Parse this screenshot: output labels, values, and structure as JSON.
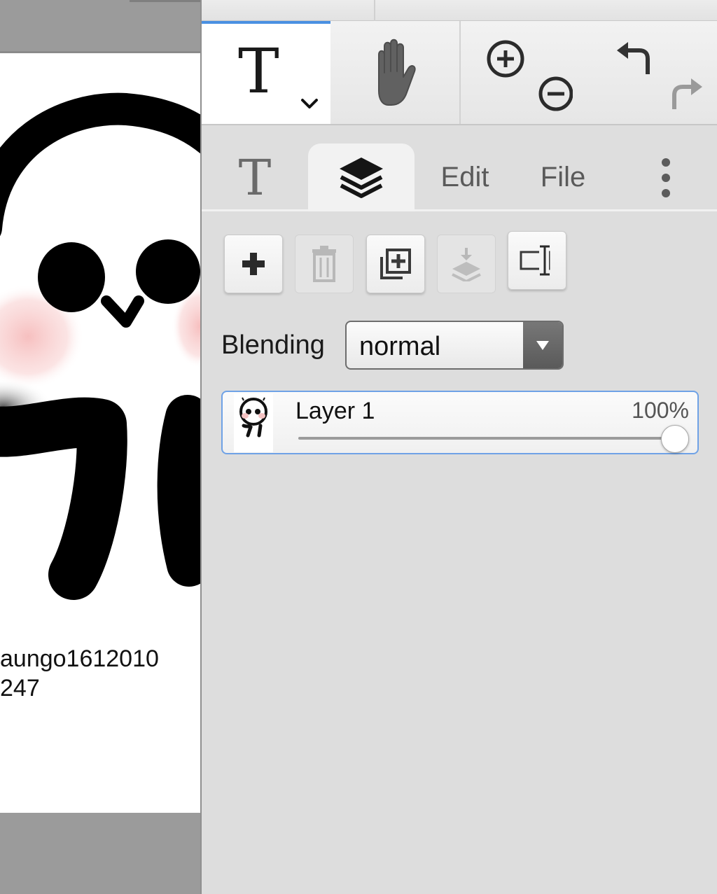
{
  "canvas": {
    "caption_line1": "aungo1612010",
    "caption_line2": "247"
  },
  "toolbar": {
    "text_tool_glyph": "T",
    "active_tool": "text",
    "icons": [
      "text-tool-icon",
      "hand-icon",
      "zoom-in-icon",
      "zoom-out-icon",
      "undo-icon",
      "redo-icon"
    ]
  },
  "tabs": {
    "text_glyph": "T",
    "edit_label": "Edit",
    "file_label": "File",
    "active": "layers"
  },
  "layers_panel": {
    "buttons": [
      {
        "name": "add-layer",
        "icon": "plus-icon",
        "enabled": true
      },
      {
        "name": "delete-layer",
        "icon": "trash-icon",
        "enabled": false
      },
      {
        "name": "duplicate-layer",
        "icon": "duplicate-icon",
        "enabled": true
      },
      {
        "name": "merge-down",
        "icon": "merge-down-icon",
        "enabled": false
      },
      {
        "name": "rename-layer",
        "icon": "rename-icon",
        "enabled": true
      }
    ],
    "blending_label": "Blending",
    "blending_value": "normal",
    "layers": [
      {
        "name": "Layer 1",
        "opacity_text": "100%",
        "opacity": 1.0
      }
    ]
  },
  "colors": {
    "accent": "#4a90e2",
    "panel_bg": "#dddddd",
    "canvas_bg": "#9b9b9b"
  }
}
